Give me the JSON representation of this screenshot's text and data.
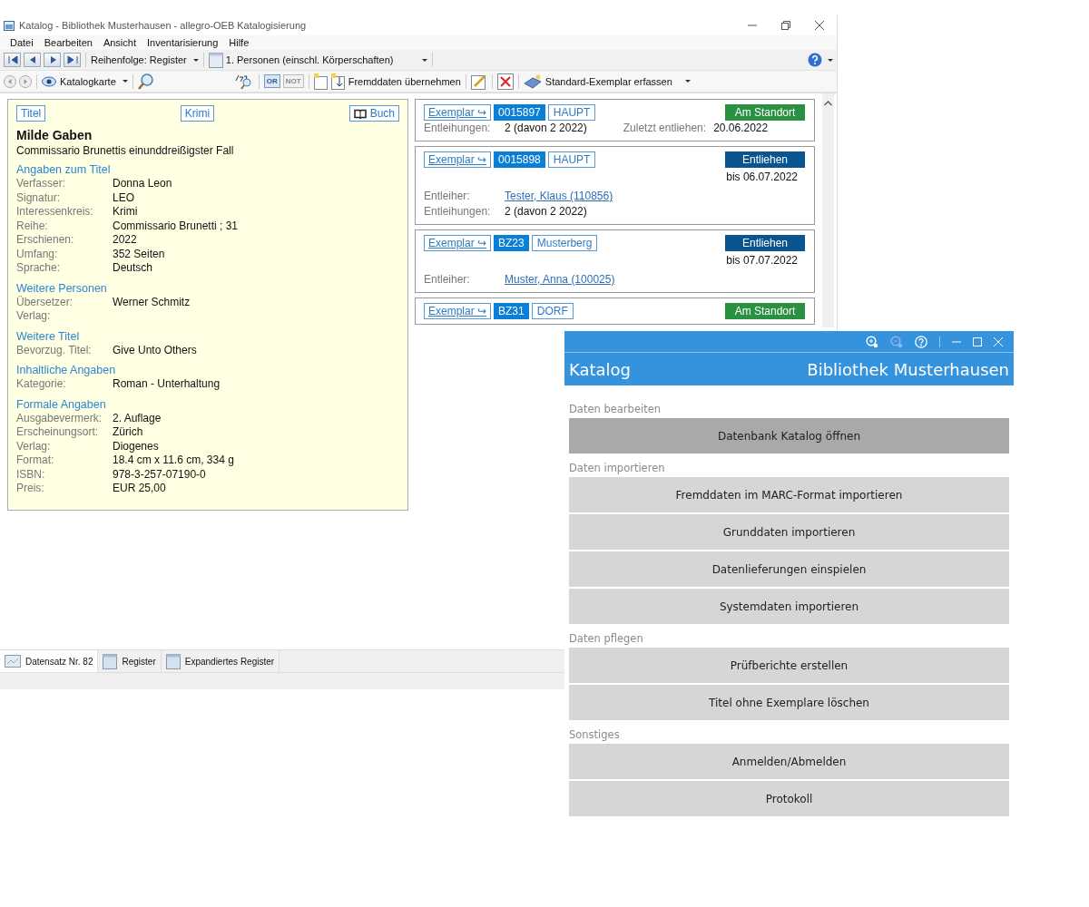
{
  "main_window": {
    "title": "Katalog - Bibliothek Musterhausen - allegro-OEB Katalogisierung",
    "menu": [
      "Datei",
      "Bearbeiten",
      "Ansicht",
      "Inventarisierung",
      "Hilfe"
    ],
    "toolbar": {
      "order_dropdown": "Reihenfolge: Register",
      "index_dropdown": "1. Personen (einschl. Körperschaften)"
    },
    "toolbar2": {
      "view_dropdown": "Katalogkarte",
      "or_button": {
        "label": "OR",
        "disabled": false
      },
      "not_button": {
        "label": "NOT",
        "disabled": true
      },
      "import_button": "Fremddaten übernehmen",
      "copy_dropdown": "Standard-Exemplar erfassen"
    },
    "record": {
      "tags": [
        {
          "label": "Titel",
          "kind": "plain"
        },
        {
          "label": "Krimi",
          "kind": "plain"
        },
        {
          "label": "Buch",
          "kind": "book"
        }
      ],
      "title": "Milde Gaben",
      "subtitle": "Commissario Brunettis einunddreißigster Fall",
      "sections": [
        {
          "heading": "Angaben zum Titel",
          "fields": [
            {
              "label": "Verfasser:",
              "value": "Donna Leon"
            },
            {
              "label": "Signatur:",
              "value": "LEO"
            },
            {
              "label": "Interessenkreis:",
              "value": "Krimi"
            },
            {
              "label": "Reihe:",
              "value": "Commissario Brunetti ; 31"
            },
            {
              "label": "Erschienen:",
              "value": "2022"
            },
            {
              "label": "Umfang:",
              "value": "352 Seiten"
            },
            {
              "label": "Sprache:",
              "value": "Deutsch"
            }
          ]
        },
        {
          "heading": "Weitere Personen",
          "fields": [
            {
              "label": "Übersetzer:",
              "value": "Werner Schmitz"
            },
            {
              "label": "Verlag:"
            }
          ]
        },
        {
          "heading": "Weitere Titel",
          "fields": [
            {
              "label": "Bevorzug. Titel:",
              "value": "Give Unto Others"
            }
          ]
        },
        {
          "heading": "Inhaltliche Angaben",
          "fields": [
            {
              "label": "Kategorie:",
              "value": "Roman - Unterhaltung"
            }
          ]
        },
        {
          "heading": "Formale Angaben",
          "fields": [
            {
              "label": "Ausgabevermerk:",
              "value": "2. Auflage"
            },
            {
              "label": "Erscheinungsort:",
              "value": "Zürich"
            },
            {
              "label": "Verlag:",
              "value": "Diogenes"
            },
            {
              "label": "Format:",
              "value": "18.4 cm x 11.6 cm, 334 g"
            },
            {
              "label": "ISBN:",
              "value": "978-3-257-07190-0"
            },
            {
              "label": "Preis:",
              "value": "EUR 25,00"
            }
          ]
        }
      ]
    },
    "copies": [
      {
        "link": "Exemplar ↪",
        "barcode": "0015897",
        "location": "HAUPT",
        "status": {
          "kind": "available",
          "label": "Am Standort"
        },
        "fields": [
          {
            "label": "Entleihungen:",
            "value": "2 (davon 2 2022)",
            "kind": "text",
            "extra_label": "Zuletzt entliehen:",
            "extra_value": "20.06.2022"
          }
        ]
      },
      {
        "link": "Exemplar ↪",
        "barcode": "0015898",
        "location": "HAUPT",
        "status": {
          "kind": "loaned",
          "label": "Entliehen"
        },
        "due": "bis 06.07.2022",
        "fields": [
          {
            "label": "Entleiher:",
            "value": "Tester, Klaus (110856)",
            "kind": "link"
          },
          {
            "label": "Entleihungen:",
            "value": "2 (davon 2 2022)",
            "kind": "text"
          }
        ]
      },
      {
        "link": "Exemplar ↪",
        "barcode": "BZ23",
        "location": "Musterberg",
        "status": {
          "kind": "loaned",
          "label": "Entliehen"
        },
        "due": "bis 07.07.2022",
        "fields": [
          {
            "label": "Entleiher:",
            "value": "Muster, Anna (100025)",
            "kind": "link"
          }
        ]
      },
      {
        "link": "Exemplar ↪",
        "barcode": "BZ31",
        "location": "DORF",
        "status": {
          "kind": "available",
          "label": "Am Standort"
        }
      }
    ],
    "bottom_tabs": [
      {
        "label": "Datensatz Nr. 82",
        "kind": "record",
        "selected": true
      },
      {
        "label": "Register",
        "kind": "folder",
        "selected": false
      },
      {
        "label": "Expandiertes Register",
        "kind": "folder",
        "selected": false
      }
    ]
  },
  "launcher": {
    "app_title": "Katalog",
    "library": "Bibliothek Musterhausen",
    "sections": [
      {
        "heading": "Daten bearbeiten",
        "buttons": [
          {
            "label": "Datenbank Katalog öffnen",
            "selected": true
          }
        ]
      },
      {
        "heading": "Daten importieren",
        "buttons": [
          {
            "label": "Fremddaten im MARC-Format importieren",
            "selected": false
          },
          {
            "label": "Grunddaten importieren",
            "selected": false
          },
          {
            "label": "Datenlieferungen einspielen",
            "selected": false
          },
          {
            "label": "Systemdaten importieren",
            "selected": false
          }
        ]
      },
      {
        "heading": "Daten pflegen",
        "buttons": [
          {
            "label": "Prüfberichte erstellen",
            "selected": false
          },
          {
            "label": "Titel ohne Exemplare löschen",
            "selected": false
          }
        ]
      },
      {
        "heading": "Sonstiges",
        "buttons": [
          {
            "label": "Anmelden/Abmelden",
            "selected": false
          },
          {
            "label": "Protokoll",
            "selected": false
          }
        ]
      }
    ]
  }
}
